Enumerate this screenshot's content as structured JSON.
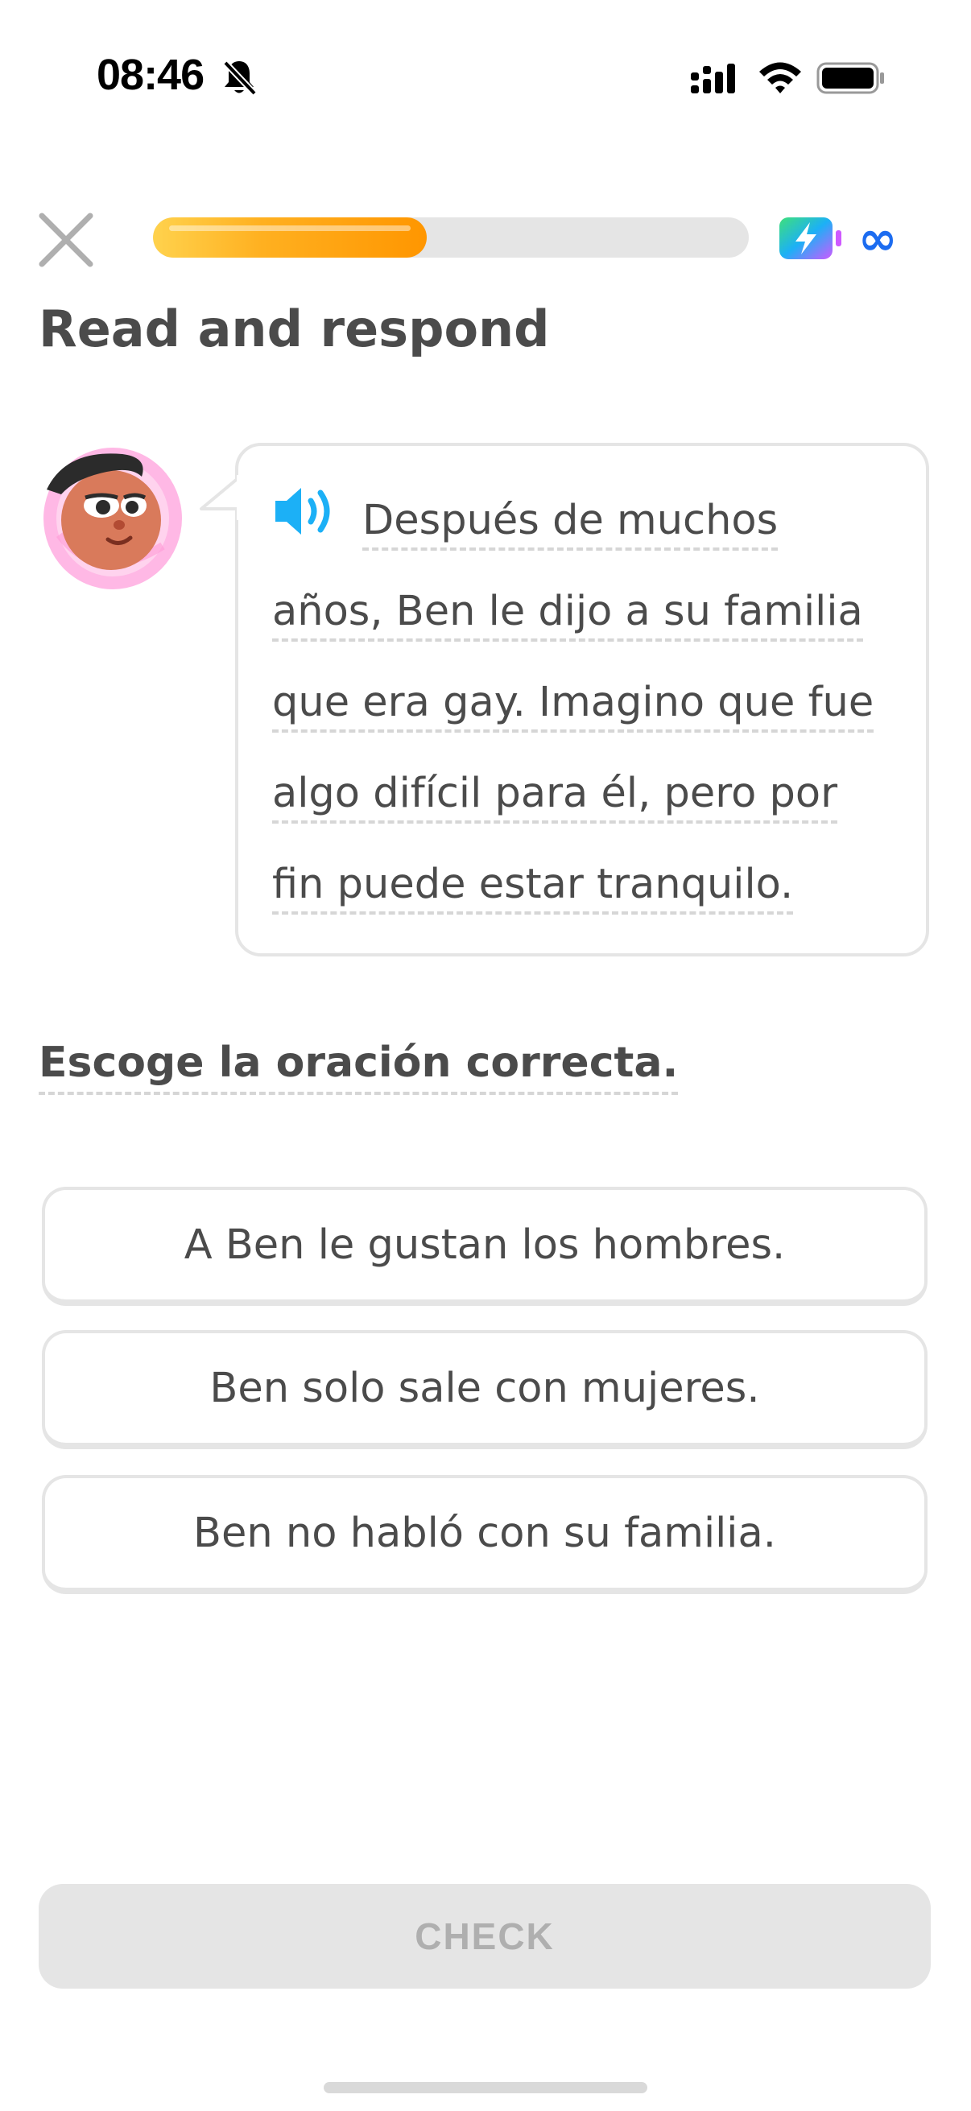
{
  "status_bar": {
    "time": "08:46"
  },
  "header": {
    "progress_percent": 46,
    "energy_label": "∞"
  },
  "exercise": {
    "title": "Read and respond",
    "passage_lines": [
      "Después de muchos",
      "años, Ben le dijo a su familia",
      "que era gay. Imagino que fue",
      "algo difícil para él, pero por",
      "fin puede estar tranquilo."
    ],
    "prompt": "Escoge la oración correcta.",
    "choices": [
      "A Ben le gustan los hombres.",
      "Ben solo sale con mujeres.",
      "Ben no habló con su familia."
    ],
    "check_label": "CHECK"
  },
  "colors": {
    "progress_fill": "#ff9600",
    "accent_blue": "#1cb0f6",
    "infinity_blue": "#1c6cf0",
    "text": "#4b4b4b",
    "disabled": "#e5e5e5"
  },
  "icons": [
    "bell-off-icon",
    "signal-icon",
    "wifi-icon",
    "battery-icon",
    "close-icon",
    "energy-icon",
    "speaker-icon"
  ]
}
